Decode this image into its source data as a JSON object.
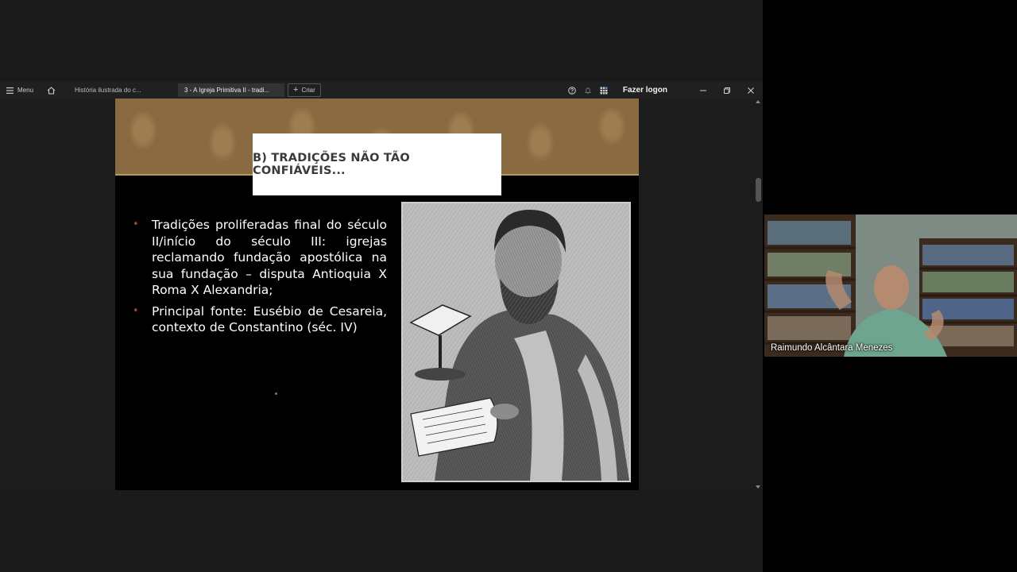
{
  "toolbar": {
    "menu_label": "Menu",
    "tabs": [
      {
        "label": "História ilustrada do c..."
      },
      {
        "label": "3 - A Igreja Primitiva II - tradi..."
      }
    ],
    "create_label": "Criar",
    "logon_label": "Fazer logon"
  },
  "slide": {
    "title": "B) TRADIÇÕES NÃO TÃO CONFIÁVEIS...",
    "bullets": [
      "Tradições proliferadas final do século II/início do século III: igrejas reclamando fundação apostólica na sua fundação – disputa Antioquia X Roma X Alexandria;",
      "Principal fonte: Eusébio de Cesareia, contexto de Constantino (séc. IV)"
    ]
  },
  "video": {
    "participant_name": "Raimundo Alcântara Menezes"
  },
  "colors": {
    "banner": "#8a6a40",
    "bullet_marker": "#a4432a",
    "toolbar_bg": "#202020"
  }
}
